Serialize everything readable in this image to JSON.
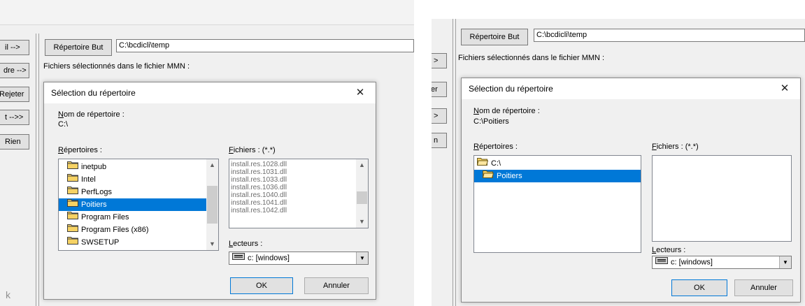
{
  "left": {
    "side_buttons": [
      "il -->",
      "dre -->",
      "Rejeter",
      "t -->>",
      "Rien"
    ],
    "bottom_fragment": "k",
    "target_dir": {
      "button": "Répertoire But",
      "value": "C:\\bcdicli\\temp"
    },
    "files_label": "Fichiers sélectionnés dans le fichier MMN :",
    "dialog": {
      "title": "Sélection du répertoire",
      "dir_name_label": "Nom de répertoire :",
      "dir_name_value": "C:\\",
      "dirs_label": "Répertoires :",
      "dirs": [
        "inetpub",
        "Intel",
        "PerfLogs",
        "Poitiers",
        "Program Files",
        "Program Files (x86)",
        "SWSETUP"
      ],
      "selected_dir": "Poitiers",
      "files_label": "Fichiers : (*.*)",
      "files": [
        "install.res.1028.dll",
        "install.res.1031.dll",
        "install.res.1033.dll",
        "install.res.1036.dll",
        "install.res.1040.dll",
        "install.res.1041.dll",
        "install.res.1042.dll"
      ],
      "drives_label": "Lecteurs :",
      "drive": "c: [windows]",
      "ok": "OK",
      "cancel": "Annuler"
    }
  },
  "right": {
    "side_buttons": [
      ">",
      "er",
      ">",
      "n"
    ],
    "target_dir": {
      "button": "Répertoire But",
      "value": "C:\\bcdicli\\temp"
    },
    "files_label": "Fichiers sélectionnés dans le fichier MMN :",
    "dialog": {
      "title": "Sélection du répertoire",
      "dir_name_label": "Nom de répertoire :",
      "dir_name_value": "C:\\Poitiers",
      "dirs_label": "Répertoires :",
      "dirs": [
        "C:\\",
        "Poitiers"
      ],
      "selected_dir": "Poitiers",
      "files_label": "Fichiers : (*.*)",
      "drives_label": "Lecteurs :",
      "drive": "c: [windows]",
      "ok": "OK",
      "cancel": "Annuler"
    }
  },
  "colors": {
    "selection": "#0078d7",
    "folder": "#f6d264",
    "panel": "#f0f0f0"
  }
}
